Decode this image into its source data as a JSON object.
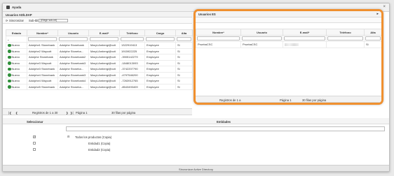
{
  "window": {
    "title": "Ayuda"
  },
  "left_panel": {
    "header": "Usuarios AD/LDAP",
    "toolbar": {
      "sync_label": "Sincronizar",
      "subtitle_label": "Sub-tbl:",
      "select_value": "(Elegir sub-int)"
    },
    "columns": [
      "Estado",
      "Nombre*",
      "Usuario",
      "E-mail*",
      "Teléfono",
      "Cargo",
      "Alta"
    ],
    "rows": [
      [
        "Nuevo",
        "Adolphe1 Stonebank",
        "Adolphe Stonebank",
        "MaryLAmbergi@vcti",
        "1322919413",
        "Employee",
        "Si"
      ],
      [
        "Nuevo",
        "Adolphe2 Waycott",
        "Adolphe Stoneba...",
        "MaryLAmbergi@vcti",
        "1915922225",
        "Employee",
        "Si"
      ],
      [
        "Nuevo",
        "Adolphe Stonebank",
        "Adolphe.Stonebank2",
        "MaryLAmbergi@vcti",
        "-3905142279",
        "Employee",
        "Si"
      ],
      [
        "Nuevo",
        "Adolphe3 Waycott",
        "Adolphe Stonebank3",
        "MaryLAmbergi@vcti",
        "-1848013093",
        "Employee",
        "Si"
      ],
      [
        "Nuevo",
        "Adolphe3 Stonebank",
        "Adolphe Stoneba...",
        "MaryLAmbergi@vcti",
        "-3742207790",
        "Employee",
        "Si"
      ],
      [
        "Nuevo",
        "Adolphe4 Stonebank",
        "Adolphe.Stonebank3",
        "MaryLAmbergi@vcti",
        "-4797546200",
        "Employee",
        "Si"
      ],
      [
        "Nuevo",
        "Adolphe4 Waycott",
        "Adolphe Stonebank4",
        "MaryLAmbergi@vcti",
        "-7263912765",
        "Employee",
        "Si"
      ],
      [
        "Nuevo",
        "Adolphe5 Stonebank",
        "Adolphe Stoneba...",
        "MaryLAmbergi@vcti",
        "-8543493409",
        "Employee",
        "Si"
      ]
    ],
    "pager": {
      "range": "Registros de 1 a 30",
      "page": "Página 1",
      "per_page": "30 filas por página"
    }
  },
  "right_panel": {
    "header": "Usuarios ES",
    "columns": [
      "Nombre*",
      "Usuario",
      "E-mail*",
      "Teléfono",
      "Alta"
    ],
    "rows": [
      [
        "PruebaCSC",
        "PruebaCSC",
        "",
        "",
        "Si"
      ]
    ],
    "pager": {
      "range": "Registros de 1 a",
      "page": "Página 1",
      "per_page": "30 filas por página"
    }
  },
  "lower": {
    "col_select": "Seleccionar",
    "col_entities": "Entidades",
    "tree": [
      {
        "label": "Todos los productos (Copia)",
        "checked": true
      },
      {
        "label": "Entidad1 (Copia)",
        "checked": false
      },
      {
        "label": "Entidad2 (Copia)",
        "checked": false
      }
    ],
    "footer_button": "Sincronizar Active Directory"
  },
  "colors": {
    "highlight": "#f0902f",
    "status_green": "#2f8f3a"
  }
}
